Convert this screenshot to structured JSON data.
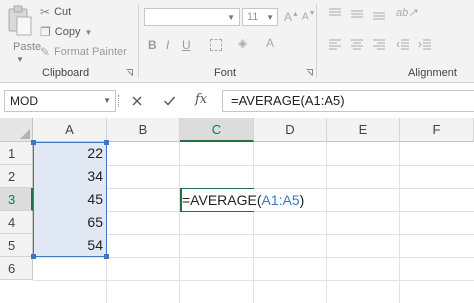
{
  "ribbon": {
    "clipboard": {
      "paste_label": "Paste",
      "cut_label": "Cut",
      "copy_label": "Copy",
      "format_painter_label": "Format Painter",
      "group_label": "Clipboard"
    },
    "font": {
      "font_name": "",
      "font_size": "11",
      "group_label": "Font",
      "bold": "B",
      "italic": "I",
      "underline": "U"
    },
    "alignment": {
      "group_label": "Alignment"
    }
  },
  "formula_bar": {
    "name_box": "MOD",
    "cancel_icon": "x-icon",
    "enter_icon": "check-icon",
    "fx_label": "fx",
    "formula": "=AVERAGE(A1:A5)"
  },
  "sheet": {
    "columns": [
      "A",
      "B",
      "C",
      "D",
      "E",
      "F"
    ],
    "rows": [
      "1",
      "2",
      "3",
      "4",
      "5",
      "6"
    ],
    "active_column": "C",
    "active_row": "3",
    "column_a_values": [
      "22",
      "34",
      "45",
      "65",
      "54"
    ],
    "edit_cell": {
      "prefix": "=AVERAGE(",
      "ref": "A1:A5",
      "suffix": ")"
    }
  },
  "colors": {
    "excel_green": "#217346",
    "selection_blue": "#3d77c2",
    "selection_fill": "#dfe8f3"
  }
}
